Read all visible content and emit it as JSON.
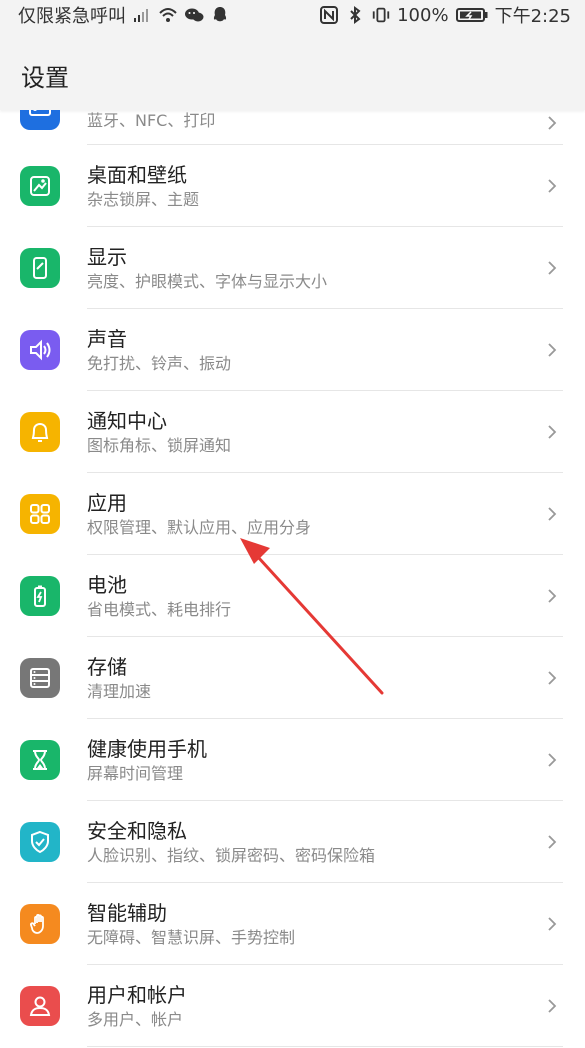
{
  "statusbar": {
    "left_text": "仅限紧急呼叫",
    "battery": "100%",
    "time": "下午2:25"
  },
  "header": {
    "title": "设置"
  },
  "items": [
    {
      "label": "",
      "subtitle": "蓝牙、NFC、打印",
      "icon": "devices-icon",
      "color": "#1e6fe0"
    },
    {
      "label": "桌面和壁纸",
      "subtitle": "杂志锁屏、主题",
      "icon": "wallpaper-icon",
      "color": "#19b66a"
    },
    {
      "label": "显示",
      "subtitle": "亮度、护眼模式、字体与显示大小",
      "icon": "display-icon",
      "color": "#19b66a"
    },
    {
      "label": "声音",
      "subtitle": "免打扰、铃声、振动",
      "icon": "sound-icon",
      "color": "#7a5cf0"
    },
    {
      "label": "通知中心",
      "subtitle": "图标角标、锁屏通知",
      "icon": "notification-icon",
      "color": "#f6b400"
    },
    {
      "label": "应用",
      "subtitle": "权限管理、默认应用、应用分身",
      "icon": "apps-icon",
      "color": "#f6b400"
    },
    {
      "label": "电池",
      "subtitle": "省电模式、耗电排行",
      "icon": "battery-icon",
      "color": "#19b66a"
    },
    {
      "label": "存储",
      "subtitle": "清理加速",
      "icon": "storage-icon",
      "color": "#777777"
    },
    {
      "label": "健康使用手机",
      "subtitle": "屏幕时间管理",
      "icon": "hourglass-icon",
      "color": "#19b66a"
    },
    {
      "label": "安全和隐私",
      "subtitle": "人脸识别、指纹、锁屏密码、密码保险箱",
      "icon": "shield-icon",
      "color": "#22b5c8"
    },
    {
      "label": "智能辅助",
      "subtitle": "无障碍、智慧识屏、手势控制",
      "icon": "hand-icon",
      "color": "#f58a1f"
    },
    {
      "label": "用户和帐户",
      "subtitle": "多用户、帐户",
      "icon": "user-icon",
      "color": "#ea4d4d"
    }
  ]
}
